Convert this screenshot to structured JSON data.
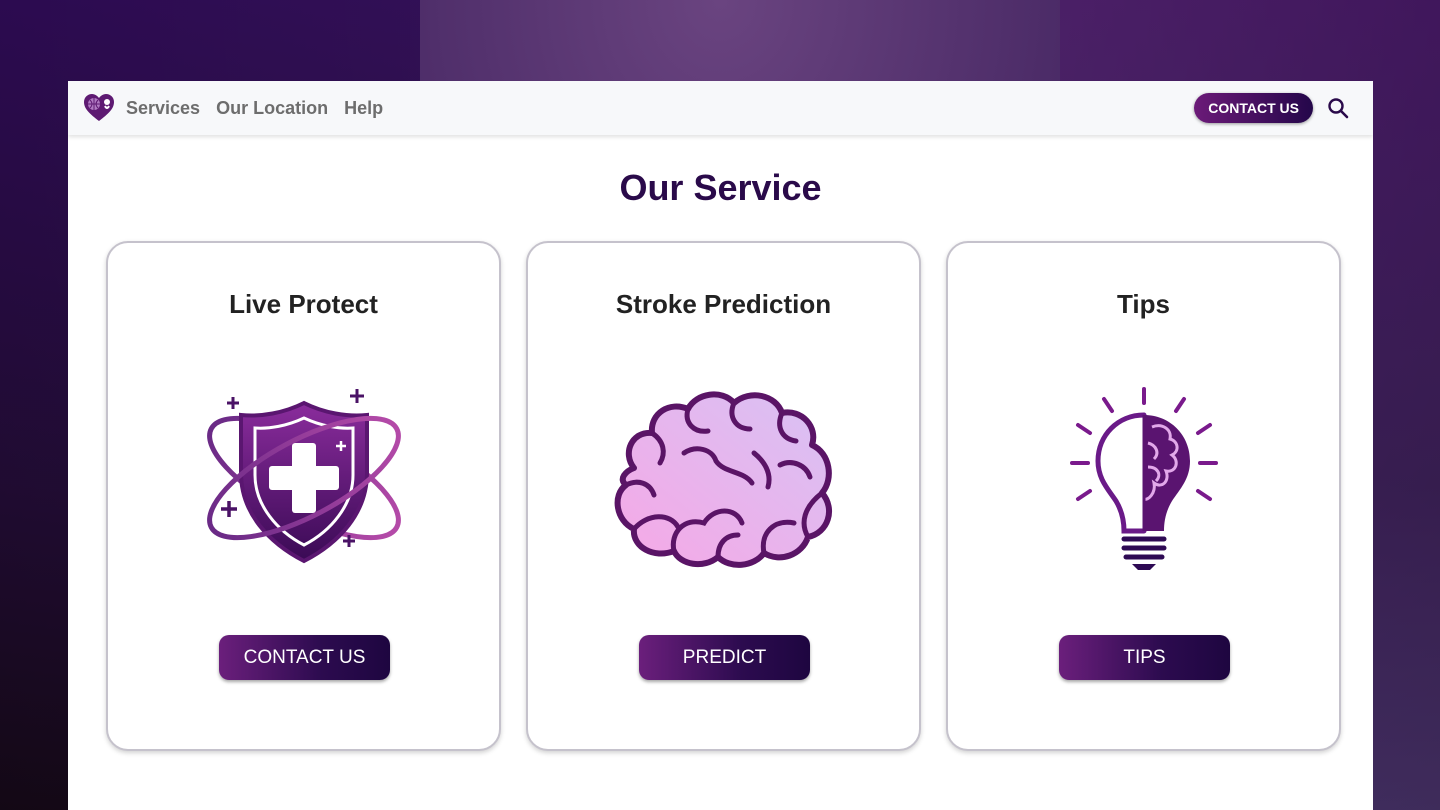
{
  "nav": {
    "links": [
      "Services",
      "Our Location",
      "Help"
    ],
    "contact_label": "CONTACT US"
  },
  "main": {
    "title": "Our Service",
    "cards": [
      {
        "title": "Live Protect",
        "button": "CONTACT US",
        "icon": "shield-plus-icon"
      },
      {
        "title": "Stroke Prediction",
        "button": "PREDICT",
        "icon": "brain-icon"
      },
      {
        "title": "Tips",
        "button": "TIPS",
        "icon": "lightbulb-brain-icon"
      }
    ]
  },
  "colors": {
    "accent_dark": "#2a0a4a",
    "accent_purple": "#6b1a78",
    "brain_pink": "#f3b0ea"
  }
}
